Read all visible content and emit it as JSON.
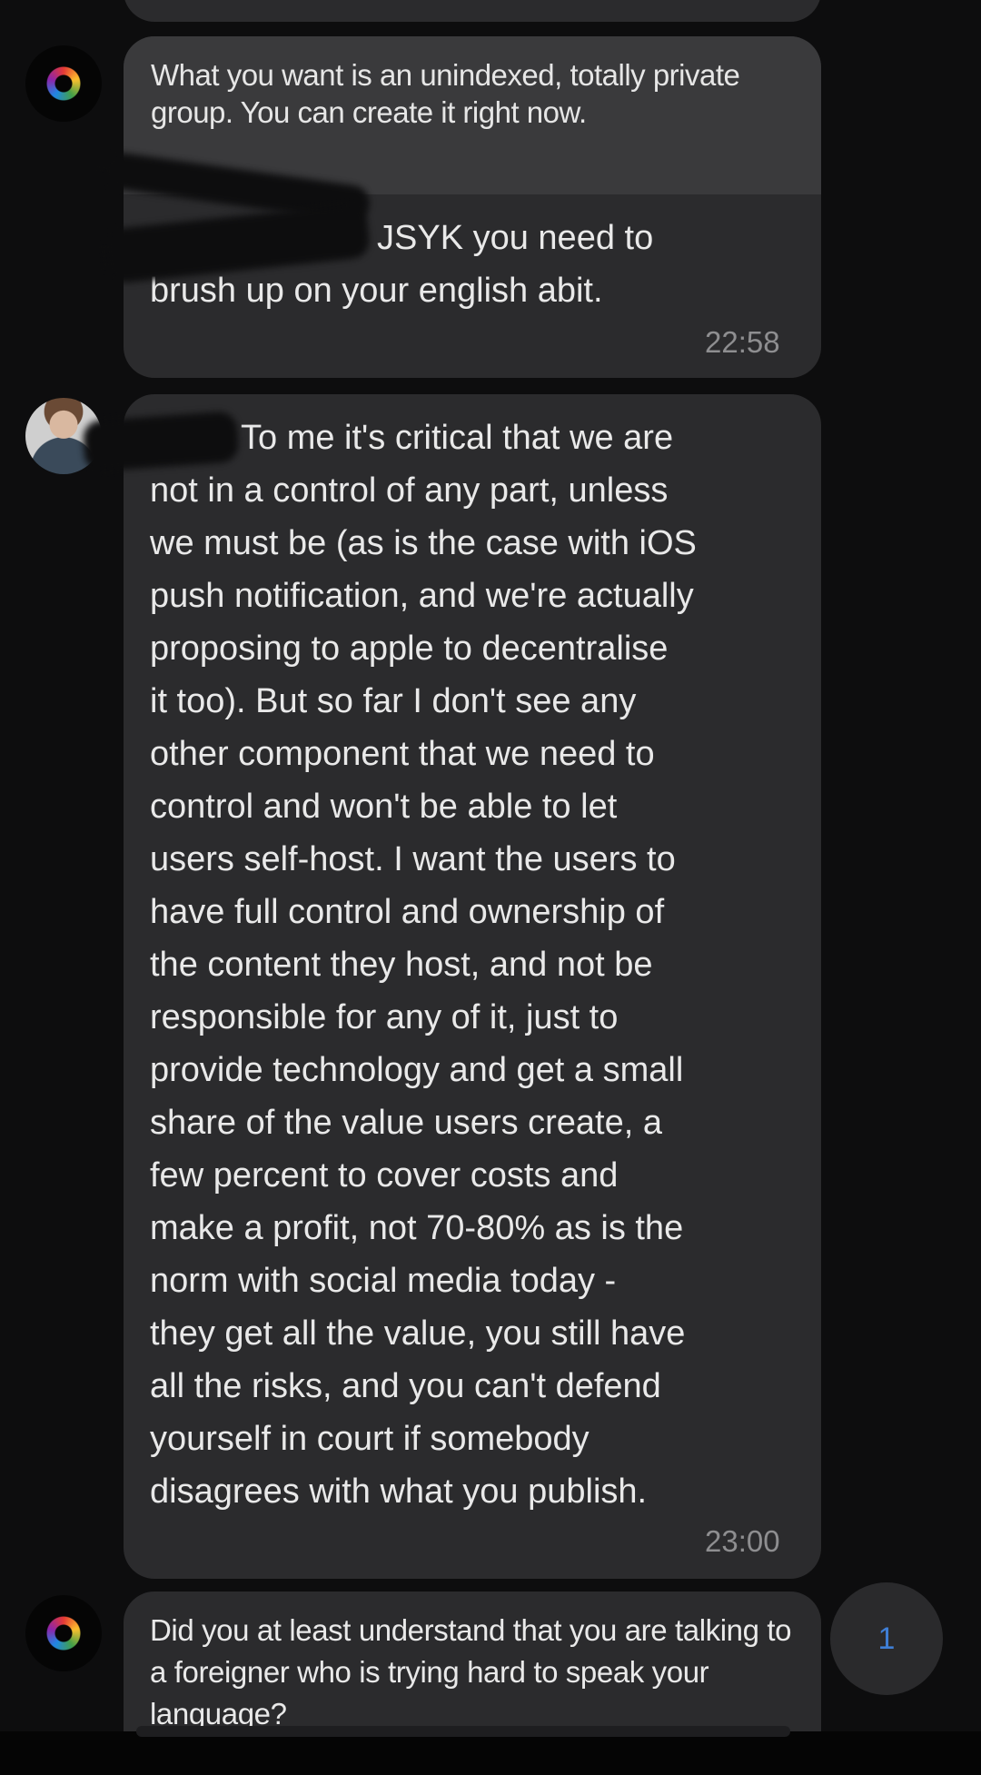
{
  "messages": [
    {
      "quoted_text": "What you want is an unindexed, totally private group. You can create it right now.",
      "reply_text": "JSYK you need to\nbrush up on your english abit.",
      "time": "22:58"
    },
    {
      "text": "To me it's critical that we are\nnot in a control of any part, unless\nwe must be (as is the case with iOS\npush notification, and we're actually\nproposing to apple to decentralise\nit too). But so far I don't see any\nother component that we need to\ncontrol and won't be able to let\nusers self-host. I want the users to\nhave full control and ownership of\nthe content they host, and not be\nresponsible for any of it, just to\nprovide technology and get a small\nshare of the value users create, a\nfew percent to cover costs and\nmake a profit, not 70-80% as is the\nnorm with social media today -\nthey get all the value, you still have\nall the risks, and you can't defend\nyourself in court if somebody\ndisagrees with what you publish.",
      "time": "23:00"
    },
    {
      "text": "Did you at least understand that you are talking to a foreigner who is trying hard to speak your language?"
    }
  ],
  "unread_badge": "1",
  "colors": {
    "background": "#0d0d0e",
    "bubble": "#2b2b2d",
    "quote": "#3a3a3c",
    "badge_text": "#3f7fd6"
  },
  "icons": {
    "avatar_1": "ring-avatar-icon",
    "avatar_2": "photo-avatar",
    "scroll_button": "unread-count-button"
  }
}
